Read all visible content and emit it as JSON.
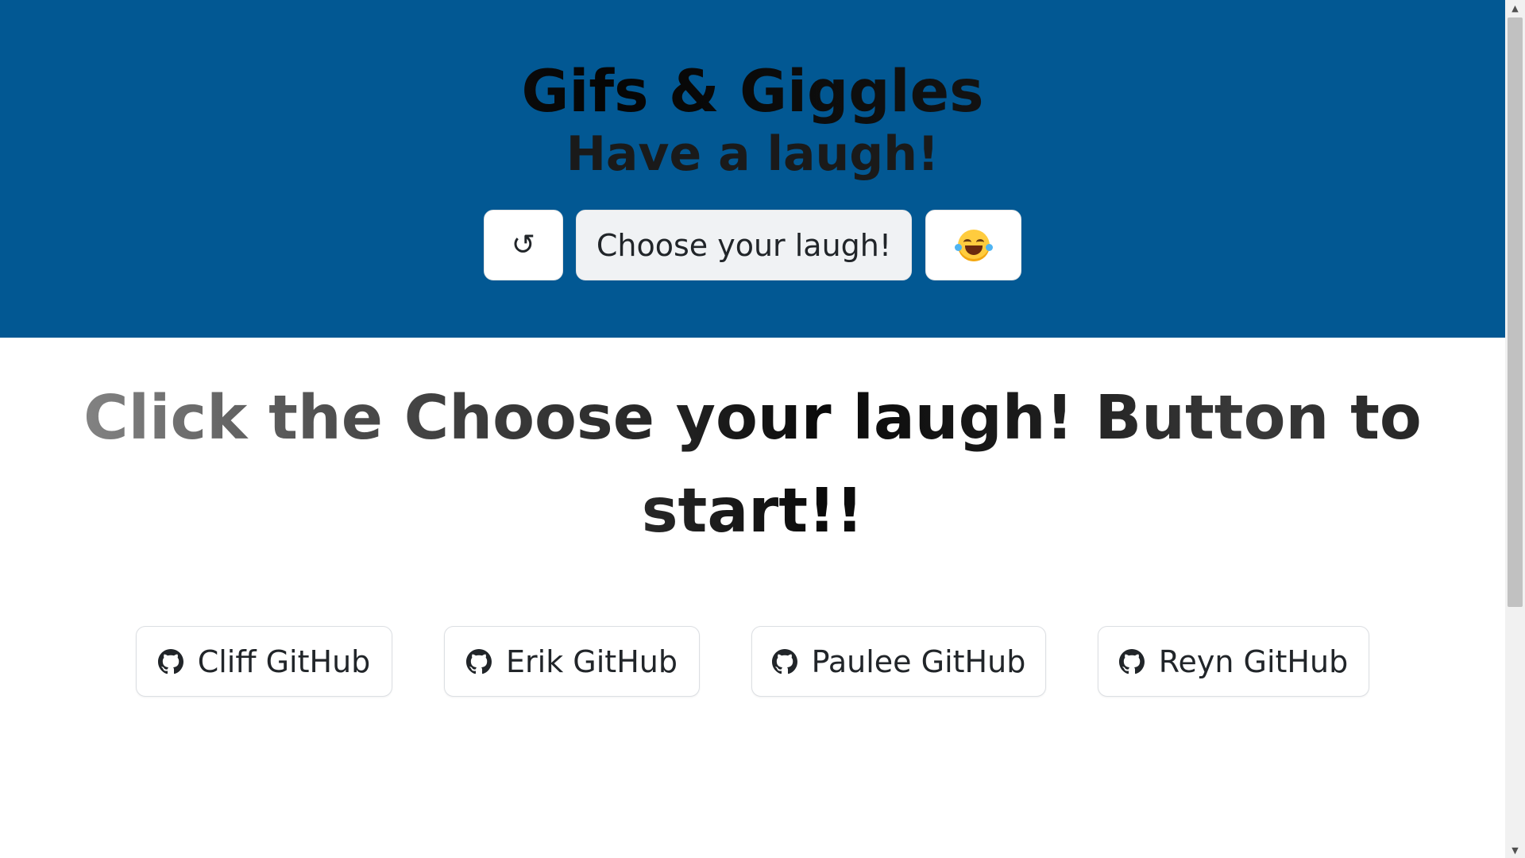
{
  "header": {
    "title": "Gifs & Giggles",
    "subtitle": "Have a laugh!",
    "refresh_label": "↺",
    "choose_label": "Choose your laugh!",
    "laugh_icon": "face-with-tears-of-joy-icon"
  },
  "main": {
    "prompt": "Click the Choose your laugh! Button to start!!"
  },
  "github_links": [
    {
      "label": "Cliff GitHub",
      "icon": "github-icon"
    },
    {
      "label": "Erik GitHub",
      "icon": "github-icon"
    },
    {
      "label": "Paulee GitHub",
      "icon": "github-icon"
    },
    {
      "label": "Reyn GitHub",
      "icon": "github-icon"
    }
  ],
  "colors": {
    "header_bg": "#025893",
    "page_bg": "#ffffff",
    "button_text": "#212529"
  }
}
